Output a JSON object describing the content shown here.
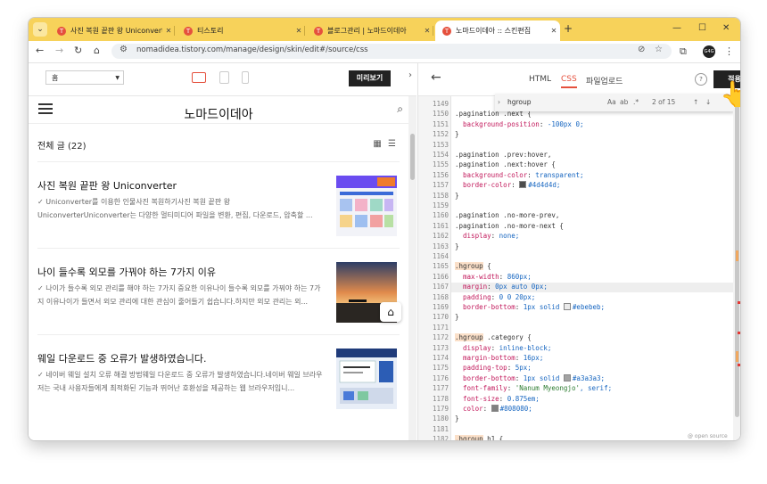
{
  "browser": {
    "tabs": [
      {
        "label": "사진 복원 끝판 왕 Uniconverter",
        "active": false
      },
      {
        "label": "티스토리",
        "active": false
      },
      {
        "label": "블로그관리 | 노마드이데아",
        "active": false
      },
      {
        "label": "노마드이데아 :: 스킨편집",
        "active": true
      }
    ],
    "url": "nomadidea.tistory.com/manage/design/skin/edit#/source/css",
    "new_tab": "+",
    "avatar": "G4G"
  },
  "preview_toolbar": {
    "select_value": "홈",
    "preview_label": "미리보기"
  },
  "blog": {
    "title": "노마드이데아",
    "post_count": "전체 글 (22)",
    "posts": [
      {
        "title": "사진 복원 끝판 왕 Uniconverter",
        "desc": "✓ Uniconverter를 이용한 인물사진 복원하기사진 복원 끝판 왕 UniconverterUniconverter는 다양한 멀티미디어 파일을 변환, 편집, 다운로드, 압축할 ..."
      },
      {
        "title": "나이 들수록 외모를 가꿔야 하는 7가지 이유",
        "desc": "✓ 나이가 들수록 외모 관리를 해야 하는 7가지 중요한 이유나이 들수록 외모를 가꿔야 하는 7가지 이유나이가 들면서 외모 관리에 대한 관심이 줄어들기 쉽습니다.하지만 외모 관리는 외..."
      },
      {
        "title": "웨일 다운로드 중 오류가 발생하였습니다.",
        "desc": "✓ 네이버 웨일 설치 오류 해결 방법웨일 다운로드 중 오류가 발생하였습니다.네이버 웨일 브라우저는 국내 사용자들에게 최적화된 기능과 뛰어난 호환성을 제공하는 웹 브라우저입니..."
      }
    ]
  },
  "editor": {
    "tabs": [
      "HTML",
      "CSS",
      "파일업로드"
    ],
    "active_tab": "CSS",
    "help": "?",
    "apply_label": "적용",
    "find_query": "hgroup",
    "find_count": "2 of 15",
    "find_opts": [
      "Aa",
      "ab",
      ".*"
    ],
    "footer": "@ open source",
    "line_numbers": [
      "1149",
      "1150",
      "1151",
      "1152",
      "1153",
      "1154",
      "1155",
      "1156",
      "1157",
      "1158",
      "1159",
      "1160",
      "1161",
      "1162",
      "1163",
      "1164",
      "1165",
      "1166",
      "1167",
      "1168",
      "1169",
      "1170",
      "1171",
      "1172",
      "1173",
      "1174",
      "1175",
      "1176",
      "1177",
      "1178",
      "1179",
      "1180",
      "1181",
      "1182"
    ],
    "code_lines": [
      "",
      ".pagination .next {",
      "  background-position: -100px 0;",
      "}",
      "",
      ".pagination .prev:hover,",
      ".pagination .next:hover {",
      "  background-color: transparent;",
      "  border-color: #4d4d4d;",
      "}",
      "",
      ".pagination .no-more-prev,",
      ".pagination .no-more-next {",
      "  display: none;",
      "}",
      "",
      ".hgroup {",
      "  max-width: 860px;",
      "  margin: 0px auto 0px;",
      "  padding: 0 0 20px;",
      "  border-bottom: 1px solid #ebebeb;",
      "}",
      "",
      ".hgroup .category {",
      "  display: inline-block;",
      "  margin-bottom: 16px;",
      "  padding-top: 5px;",
      "  border-bottom: 1px solid #a3a3a3;",
      "  font-family: 'Nanum Myeongjo', serif;",
      "  font-size: 0.875em;",
      "  color: #808080;",
      "}",
      "",
      ".hgroup h1 {"
    ]
  },
  "colors": {
    "tab_strip": "#f7d25a",
    "accent": "#e5503d",
    "swatch_4d": "#4d4d4d",
    "swatch_eb": "#ebebeb",
    "swatch_a3": "#a3a3a3",
    "swatch_80": "#808080"
  }
}
